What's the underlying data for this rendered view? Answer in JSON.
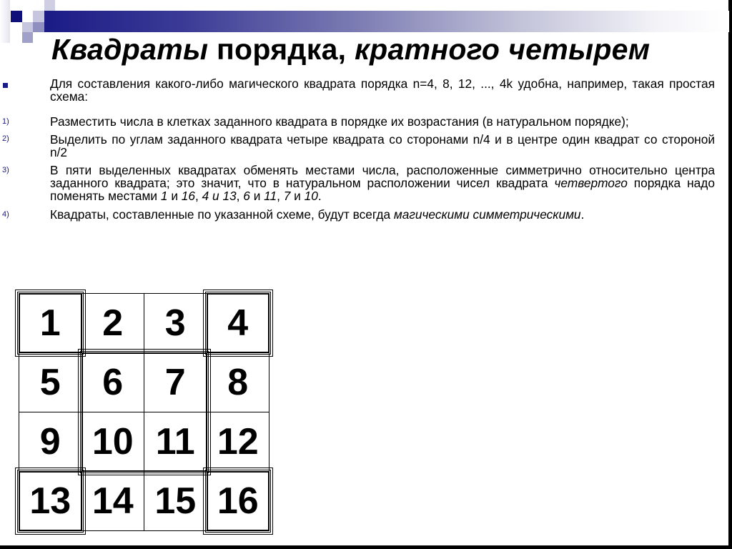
{
  "title": {
    "part1_italic": "Квадраты",
    "part2": " порядка, ",
    "part3_italic": "кратного четырем"
  },
  "intro": {
    "bullet_icon": "square-bullet",
    "text": "Для составления какого-либо магического квадрата порядка n=4, 8, 12, ..., 4k удобна, например, такая простая схема:"
  },
  "steps": [
    {
      "marker": "1)",
      "text": "Разместить числа в клетках заданного квадрата в порядке их возрастания (в натуральном порядке);"
    },
    {
      "marker": "2)",
      "text": "Выделить по углам заданного квадрата четыре квадрата со сторонами n/4  и в центре один квадрат со стороной n/2"
    },
    {
      "marker": "3)",
      "text_a": "В пяти выделенных квадратах обменять местами числа, расположенные симметрично относительно центра заданного квадрата; это значит, что в натуральном расположении чисел квадрата ",
      "text_b_italic": "четвертого",
      "text_c": " порядка надо поменять местами ",
      "pairs": [
        {
          "a": "1",
          "sep": " и ",
          "b": "16",
          "tail": ", "
        },
        {
          "a": "4 и 13",
          "sep": "",
          "b": "",
          "tail": ", "
        },
        {
          "a": "6",
          "sep": " и ",
          "b": "11",
          "tail": ", "
        },
        {
          "a": "7",
          "sep": " и ",
          "b": "10",
          "tail": "."
        }
      ]
    },
    {
      "marker": "4)",
      "text_a": "Квадраты, составленные по указанной схеме, будут всегда ",
      "text_b_italic": "магическими симметрическими",
      "text_c": "."
    }
  ],
  "square": {
    "order": 4,
    "cells": [
      [
        1,
        2,
        3,
        4
      ],
      [
        5,
        6,
        7,
        8
      ],
      [
        9,
        10,
        11,
        12
      ],
      [
        13,
        14,
        15,
        16
      ]
    ],
    "highlighted_blocks": [
      "top-left corner",
      "top-right corner",
      "bottom-left corner",
      "bottom-right corner",
      "center 2x2"
    ]
  }
}
